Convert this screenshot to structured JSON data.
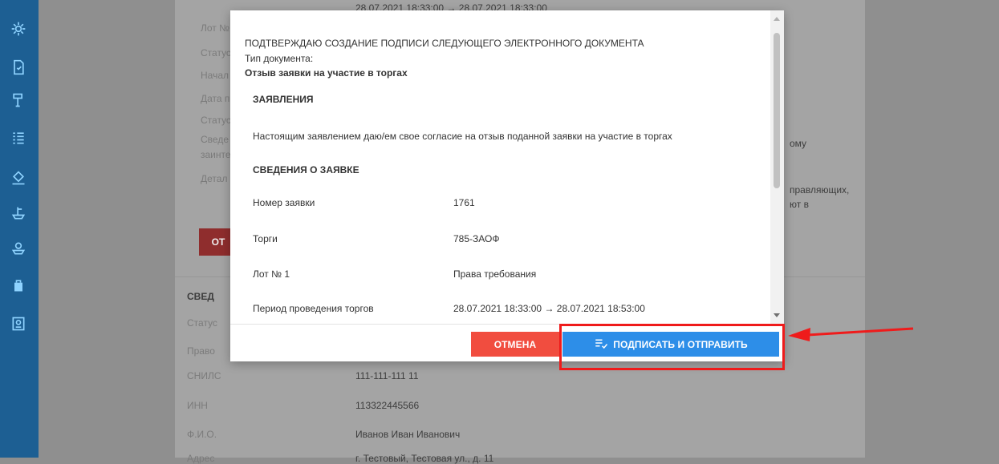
{
  "sidebar": {
    "icons": [
      "gear-icon",
      "document-icon",
      "hammer-icon",
      "list-icon",
      "gavel-icon",
      "boat-icon",
      "ship-icon",
      "bag-icon",
      "id-card-icon"
    ]
  },
  "background": {
    "top_value": "28.07.2021 18:33:00 → 28.07.2021 18:33:00",
    "labels": [
      "Лот №",
      "Статус",
      "Начал",
      "Дата п",
      "Статус",
      "Сведе",
      "заинте",
      "Детал"
    ],
    "right_fragments": [
      "ому",
      "правляющих,",
      "ют в"
    ],
    "red_button": "ОТ",
    "section_title": "СВЕД",
    "lower_labels": [
      "Статус",
      "Право",
      "СНИЛС",
      "ИНН",
      "Ф.И.О.",
      "Адрес"
    ],
    "lower_values": [
      "111-111-111 11",
      "113322445566",
      "Иванов Иван Иванович",
      "г. Тестовый, Тестовая ул., д. 11"
    ]
  },
  "modal": {
    "title": "ПОДТВЕРЖДАЮ СОЗДАНИЕ ПОДПИСИ СЛЕДУЮЩЕГО ЭЛЕКТРОННОГО ДОКУМЕНТА",
    "doc_type_label": "Тип документа:",
    "doc_type_value": "Отзыв заявки на участие в торгах",
    "statement_heading": "ЗАЯВЛЕНИЯ",
    "statement_text": "Настоящим заявлением даю/ем свое согласие на отзыв поданной заявки на участие в торгах",
    "details_heading": "СВЕДЕНИЯ О ЗАЯВКЕ",
    "details": [
      {
        "label": "Номер заявки",
        "value": "1761"
      },
      {
        "label": "Торги",
        "value": "785-ЗАОФ"
      },
      {
        "label": "Лот № 1",
        "value": "Права требования"
      },
      {
        "label": "Период проведения торгов",
        "value": "28.07.2021 18:33:00 → 28.07.2021 18:53:00"
      }
    ],
    "cancel_label": "ОТМЕНА",
    "sign_label": "ПОДПИСАТЬ И ОТПРАВИТЬ"
  },
  "colors": {
    "sidebar": "#1d5f93",
    "cancel": "#f14d3f",
    "sign": "#2d8ee8",
    "highlight": "#ef1b1b"
  }
}
